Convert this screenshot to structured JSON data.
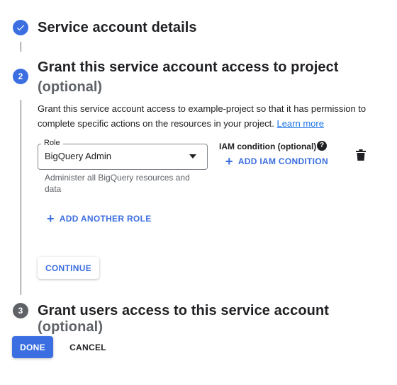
{
  "steps": [
    {
      "number": "1",
      "title": "Service account details",
      "status": "completed"
    },
    {
      "number": "2",
      "title": "Grant this service account access to project",
      "optional": "(optional)",
      "status": "active"
    },
    {
      "number": "3",
      "title": "Grant users access to this service account",
      "optional": "(optional)",
      "status": "pending"
    }
  ],
  "step2": {
    "description": "Grant this service account access to example-project so that it has permission to complete specific actions on the resources in your project.",
    "learn_more": "Learn more",
    "role": {
      "label": "Role",
      "value": "BigQuery Admin",
      "helper": "Administer all BigQuery resources and data"
    },
    "iam_condition_label": "IAM condition (optional)",
    "add_iam_condition": "ADD IAM CONDITION",
    "add_another_role": "ADD ANOTHER ROLE",
    "continue": "CONTINUE"
  },
  "footer": {
    "done": "DONE",
    "cancel": "CANCEL"
  },
  "colors": {
    "accent": "#3b6ee0",
    "link": "#1a73e8",
    "muted": "#5f6368"
  }
}
